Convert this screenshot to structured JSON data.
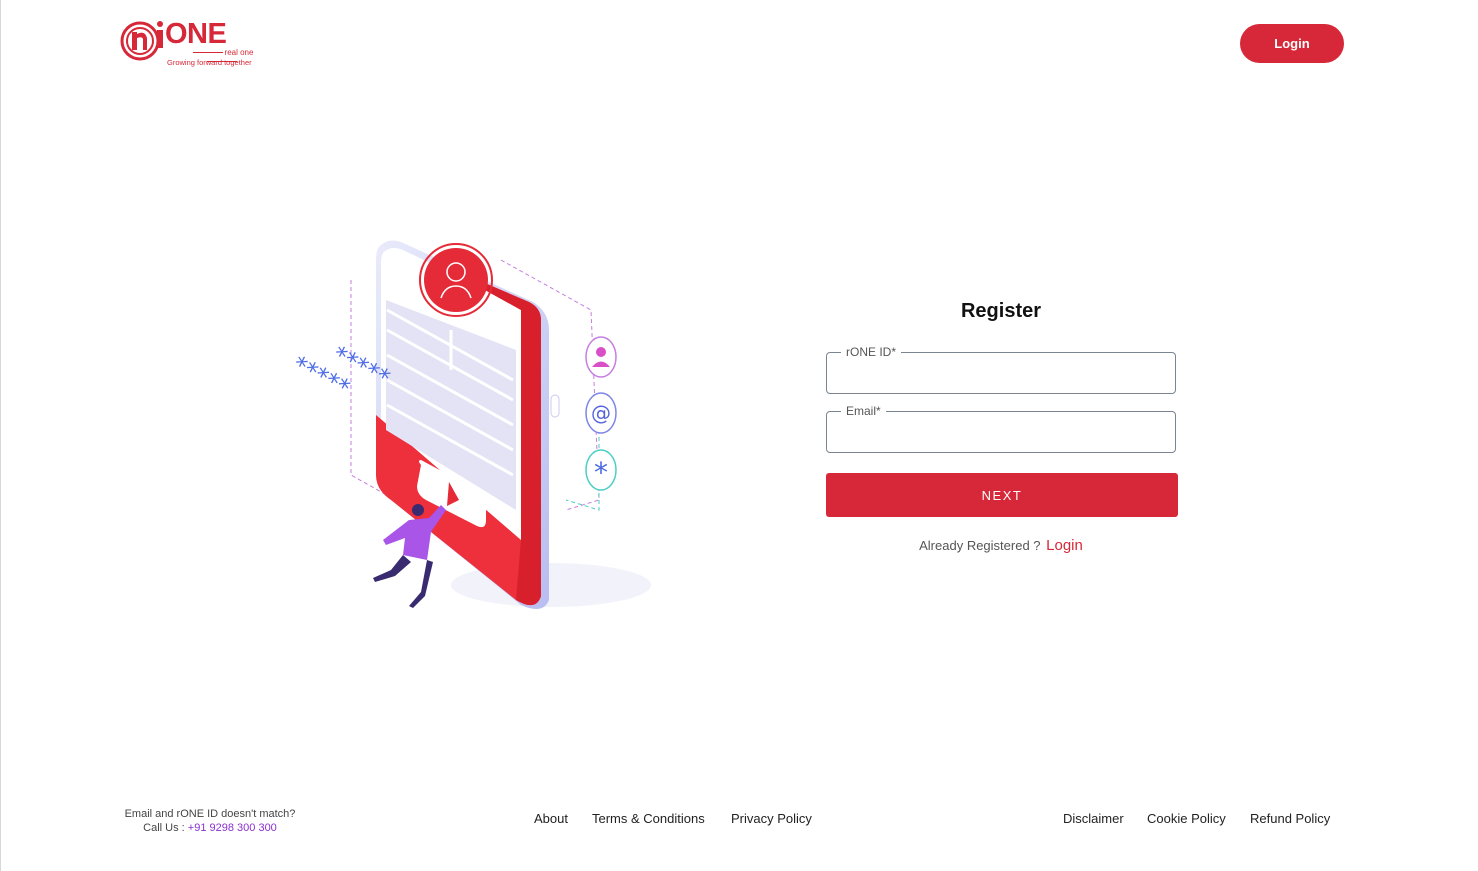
{
  "header": {
    "logo": {
      "brand": "ONE",
      "subtitle": "real one",
      "tagline": "Growing forward together"
    },
    "login_button": "Login"
  },
  "illustration": {
    "stars_1": "*****",
    "stars_2": "*****"
  },
  "form": {
    "title": "Register",
    "rone_id_label": "rONE ID*",
    "rone_id_value": "",
    "email_label": "Email*",
    "email_value": "",
    "next_button": "NEXT",
    "already_registered": "Already Registered ?",
    "login_link": "Login"
  },
  "footer": {
    "mismatch_text": "Email and rONE ID doesn't match?",
    "call_us": "Call Us :",
    "phone": "+91 9298 300 300",
    "links": [
      "About",
      "Terms & Conditions",
      "Privacy Policy",
      "Disclaimer",
      "Cookie Policy",
      "Refund Policy"
    ]
  },
  "colors": {
    "brand_red": "#d62838",
    "phone_purple": "#8a2fd0"
  }
}
